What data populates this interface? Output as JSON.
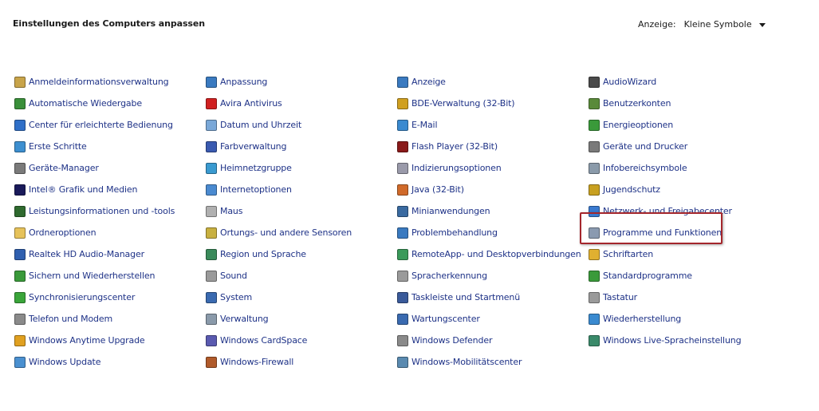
{
  "header": {
    "title": "Einstellungen des Computers anpassen",
    "view_label": "Anzeige:",
    "view_value": "Kleine Symbole"
  },
  "columns": [
    [
      {
        "label": "Anmeldeinformationsverwaltung",
        "icon": "credential-icon",
        "color": "#c8a44a"
      },
      {
        "label": "Automatische Wiedergabe",
        "icon": "autoplay-icon",
        "color": "#3a8f3a"
      },
      {
        "label": "Center für erleichterte Bedienung",
        "icon": "accessibility-icon",
        "color": "#2f6fc8"
      },
      {
        "label": "Erste Schritte",
        "icon": "getting-started-icon",
        "color": "#3d8fd0"
      },
      {
        "label": "Geräte-Manager",
        "icon": "device-manager-icon",
        "color": "#7a7a7a"
      },
      {
        "label": "Intel® Grafik und Medien",
        "icon": "intel-graphics-icon",
        "color": "#1a1a5a"
      },
      {
        "label": "Leistungsinformationen und -tools",
        "icon": "performance-icon",
        "color": "#2f6a2f"
      },
      {
        "label": "Ordneroptionen",
        "icon": "folder-options-icon",
        "color": "#e6c25a"
      },
      {
        "label": "Realtek HD Audio-Manager",
        "icon": "realtek-icon",
        "color": "#2f5faf"
      },
      {
        "label": "Sichern und Wiederherstellen",
        "icon": "backup-icon",
        "color": "#3a9a3a"
      },
      {
        "label": "Synchronisierungscenter",
        "icon": "sync-icon",
        "color": "#3aa53a"
      },
      {
        "label": "Telefon und Modem",
        "icon": "phone-modem-icon",
        "color": "#8a8a8a"
      },
      {
        "label": "Windows Anytime Upgrade",
        "icon": "windows-upgrade-icon",
        "color": "#e0a020"
      },
      {
        "label": "Windows Update",
        "icon": "windows-update-icon",
        "color": "#4a90d0"
      }
    ],
    [
      {
        "label": "Anpassung",
        "icon": "personalization-icon",
        "color": "#3a7ac0"
      },
      {
        "label": "Avira Antivirus",
        "icon": "avira-icon",
        "color": "#d02020"
      },
      {
        "label": "Datum und Uhrzeit",
        "icon": "date-time-icon",
        "color": "#7aa8d8"
      },
      {
        "label": "Farbverwaltung",
        "icon": "color-management-icon",
        "color": "#3a5ab0"
      },
      {
        "label": "Heimnetzgruppe",
        "icon": "homegroup-icon",
        "color": "#3a9ad0"
      },
      {
        "label": "Internetoptionen",
        "icon": "internet-options-icon",
        "color": "#4a8ad0"
      },
      {
        "label": "Maus",
        "icon": "mouse-icon",
        "color": "#b0b0b0"
      },
      {
        "label": "Ortungs- und andere Sensoren",
        "icon": "sensors-icon",
        "color": "#c8b040"
      },
      {
        "label": "Region und Sprache",
        "icon": "region-language-icon",
        "color": "#3a8a5a"
      },
      {
        "label": "Sound",
        "icon": "sound-icon",
        "color": "#9a9a9a"
      },
      {
        "label": "System",
        "icon": "system-icon",
        "color": "#3a6ab0"
      },
      {
        "label": "Verwaltung",
        "icon": "administrative-tools-icon",
        "color": "#8a9aaa"
      },
      {
        "label": "Windows CardSpace",
        "icon": "cardspace-icon",
        "color": "#5a5ab0"
      },
      {
        "label": "Windows-Firewall",
        "icon": "firewall-icon",
        "color": "#b05a2a"
      }
    ],
    [
      {
        "label": "Anzeige",
        "icon": "display-icon",
        "color": "#3a7ac0"
      },
      {
        "label": "BDE-Verwaltung (32-Bit)",
        "icon": "bde-icon",
        "color": "#d0a020"
      },
      {
        "label": "E-Mail",
        "icon": "email-icon",
        "color": "#3a8ad0"
      },
      {
        "label": "Flash Player (32-Bit)",
        "icon": "flash-icon",
        "color": "#8a1a1a"
      },
      {
        "label": "Indizierungsoptionen",
        "icon": "indexing-icon",
        "color": "#9a9aaa"
      },
      {
        "label": "Java (32-Bit)",
        "icon": "java-icon",
        "color": "#d06a2a"
      },
      {
        "label": "Minianwendungen",
        "icon": "gadgets-icon",
        "color": "#3a6aa0"
      },
      {
        "label": "Problembehandlung",
        "icon": "troubleshooting-icon",
        "color": "#3a7ac0"
      },
      {
        "label": "RemoteApp- und Desktopverbindungen",
        "icon": "remoteapp-icon",
        "color": "#3a9a5a"
      },
      {
        "label": "Spracherkennung",
        "icon": "speech-icon",
        "color": "#9a9a9a"
      },
      {
        "label": "Taskleiste und Startmenü",
        "icon": "taskbar-icon",
        "color": "#3a5a9a"
      },
      {
        "label": "Wartungscenter",
        "icon": "action-center-icon",
        "color": "#3a6ab0"
      },
      {
        "label": "Windows Defender",
        "icon": "defender-icon",
        "color": "#8a8a8a"
      },
      {
        "label": "Windows-Mobilitätscenter",
        "icon": "mobility-center-icon",
        "color": "#5a8ab0"
      }
    ],
    [
      {
        "label": "AudioWizard",
        "icon": "audiowizard-icon",
        "color": "#4a4a4a"
      },
      {
        "label": "Benutzerkonten",
        "icon": "user-accounts-icon",
        "color": "#5a8a3a"
      },
      {
        "label": "Energieoptionen",
        "icon": "power-options-icon",
        "color": "#3a9a3a"
      },
      {
        "label": "Geräte und Drucker",
        "icon": "devices-printers-icon",
        "color": "#7a7a7a"
      },
      {
        "label": "Infobereichsymbole",
        "icon": "notification-icons-icon",
        "color": "#8a9aaa"
      },
      {
        "label": "Jugendschutz",
        "icon": "parental-controls-icon",
        "color": "#c8a020"
      },
      {
        "label": "Netzwerk- und Freigabecenter",
        "icon": "network-sharing-icon",
        "color": "#3a7ad0"
      },
      {
        "label": "Programme und Funktionen",
        "icon": "programs-features-icon",
        "color": "#8a9ab0"
      },
      {
        "label": "Schriftarten",
        "icon": "fonts-icon",
        "color": "#e0b030"
      },
      {
        "label": "Standardprogramme",
        "icon": "default-programs-icon",
        "color": "#3a9a3a"
      },
      {
        "label": "Tastatur",
        "icon": "keyboard-icon",
        "color": "#9a9a9a"
      },
      {
        "label": "Wiederherstellung",
        "icon": "recovery-icon",
        "color": "#3a8ad0"
      },
      {
        "label": "Windows Live-Spracheinstellung",
        "icon": "windows-live-language-icon",
        "color": "#3a8a6a"
      }
    ]
  ],
  "highlight_color": "#a4262c"
}
